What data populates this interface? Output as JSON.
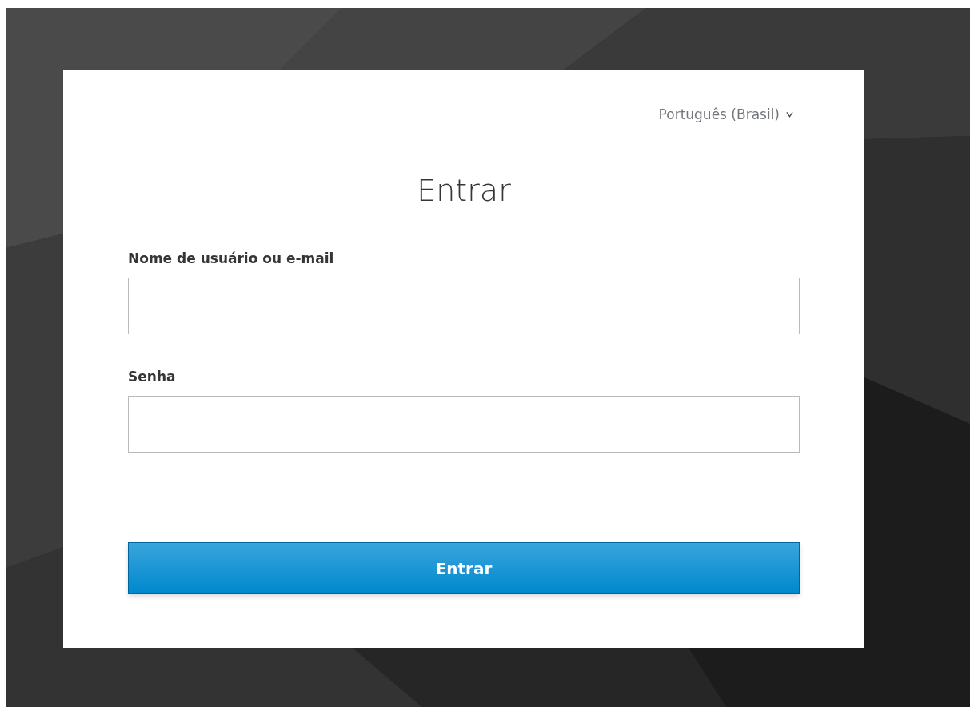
{
  "language": {
    "label": "Português (Brasil)"
  },
  "title": "Entrar",
  "fields": [
    {
      "label": "Nome de usuário ou e-mail"
    },
    {
      "label": "Senha"
    }
  ],
  "submit_button": {
    "label": "Entrar"
  }
}
